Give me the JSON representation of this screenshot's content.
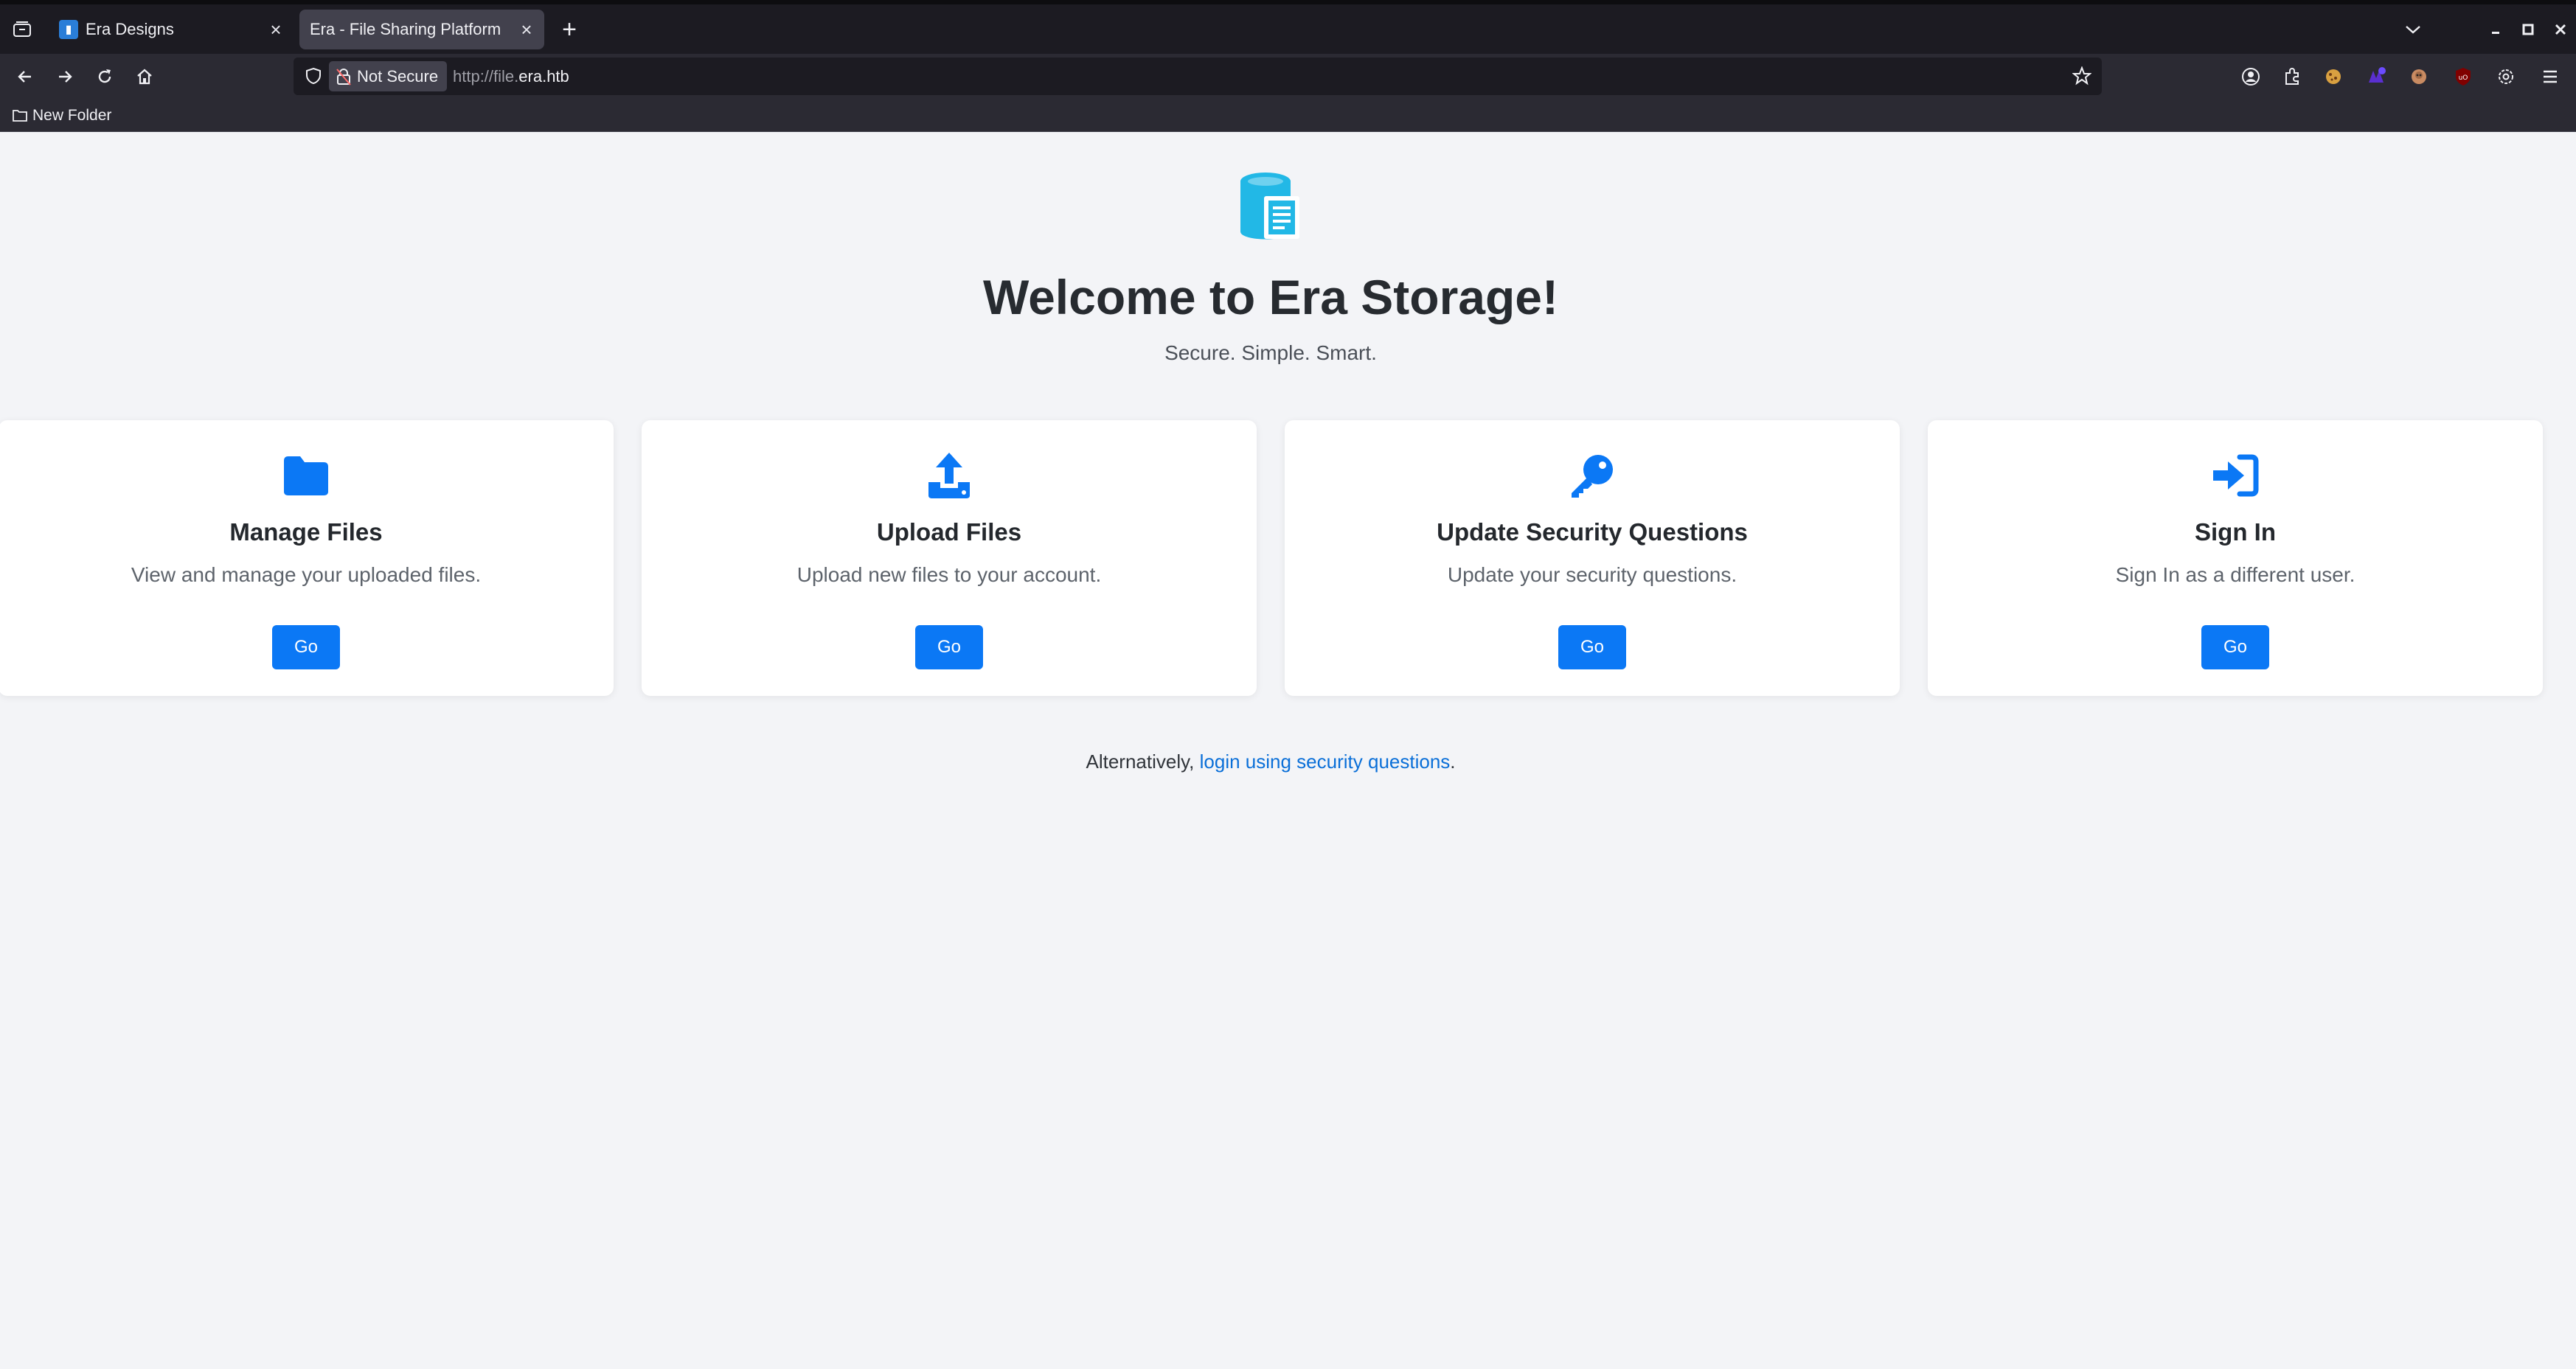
{
  "browser": {
    "tabs": [
      {
        "title": "Era Designs",
        "active": false
      },
      {
        "title": "Era - File Sharing Platform",
        "active": true
      }
    ],
    "url_security_label": "Not Secure",
    "url_prefix": "http://file.",
    "url_host": "era.htb",
    "bookmarks": [
      {
        "label": "New Folder"
      }
    ]
  },
  "page": {
    "title": "Welcome to Era Storage!",
    "tagline": "Secure. Simple. Smart.",
    "accent_color": "#0b78f5",
    "cards": [
      {
        "title": "Manage Files",
        "description": "View and manage your uploaded files.",
        "button": "Go",
        "icon": "folder-icon"
      },
      {
        "title": "Upload Files",
        "description": "Upload new files to your account.",
        "button": "Go",
        "icon": "upload-icon"
      },
      {
        "title": "Update Security Questions",
        "description": "Update your security questions.",
        "button": "Go",
        "icon": "key-icon"
      },
      {
        "title": "Sign In",
        "description": "Sign In as a different user.",
        "button": "Go",
        "icon": "sign-in-icon"
      }
    ],
    "alternative": {
      "prefix": "Alternatively,",
      "link_text": "login using security questions",
      "suffix": "."
    }
  }
}
